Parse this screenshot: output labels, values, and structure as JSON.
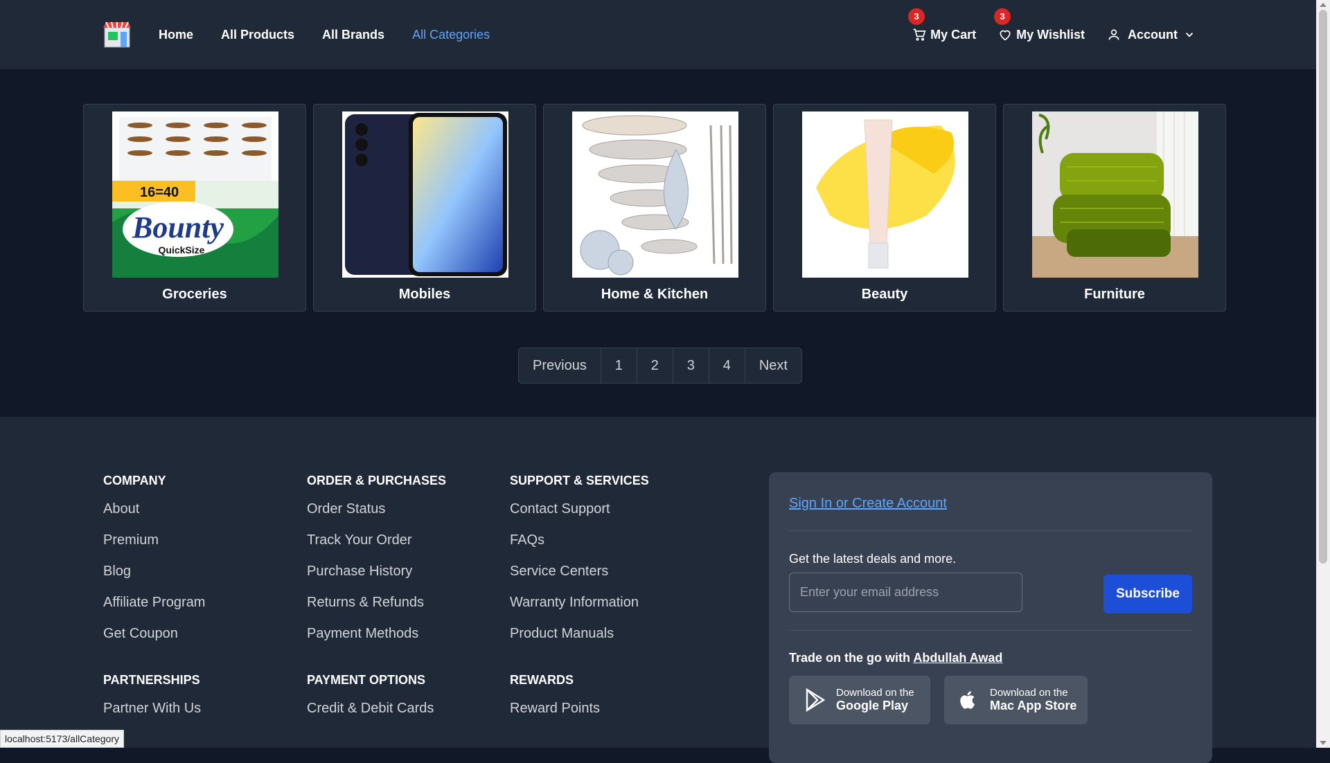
{
  "nav": {
    "links": [
      "Home",
      "All Products",
      "All Brands",
      "All Categories"
    ],
    "cart_label": "My Cart",
    "cart_count": "3",
    "wishlist_label": "My Wishlist",
    "wishlist_count": "3",
    "account_label": "Account"
  },
  "categories": [
    {
      "name": "Groceries"
    },
    {
      "name": "Mobiles"
    },
    {
      "name": "Home & Kitchen"
    },
    {
      "name": "Beauty"
    },
    {
      "name": "Furniture"
    }
  ],
  "pagination": {
    "prev": "Previous",
    "pages": [
      "1",
      "2",
      "3",
      "4"
    ],
    "next": "Next"
  },
  "footer": {
    "columns": [
      {
        "heading": "COMPANY",
        "links": [
          "About",
          "Premium",
          "Blog",
          "Affiliate Program",
          "Get Coupon"
        ],
        "heading2": "PARTNERSHIPS",
        "links2": [
          "Partner With Us"
        ]
      },
      {
        "heading": "ORDER & PURCHASES",
        "links": [
          "Order Status",
          "Track Your Order",
          "Purchase History",
          "Returns & Refunds",
          "Payment Methods"
        ],
        "heading2": "PAYMENT OPTIONS",
        "links2": [
          "Credit & Debit Cards"
        ]
      },
      {
        "heading": "SUPPORT & SERVICES",
        "links": [
          "Contact Support",
          "FAQs",
          "Service Centers",
          "Warranty Information",
          "Product Manuals"
        ],
        "heading2": "REWARDS",
        "links2": [
          "Reward Points"
        ]
      }
    ],
    "signin_label": "Sign In or Create Account",
    "deals_text": "Get the latest deals and more.",
    "email_placeholder": "Enter your email address",
    "subscribe_label": "Subscribe",
    "trade_text": "Trade on the go with",
    "trade_author": "Abdullah Awad",
    "google_small": "Download on the",
    "google_big": "Google Play",
    "apple_small": "Download on the",
    "apple_big": "Mac App Store"
  },
  "status_url": "localhost:5173/allCategory",
  "colors": {
    "page_bg": "#111827",
    "navbar_bg": "#1f2937",
    "active_link": "#60a5fa",
    "badge": "#dc2626",
    "subscribe": "#1d4ed8"
  }
}
